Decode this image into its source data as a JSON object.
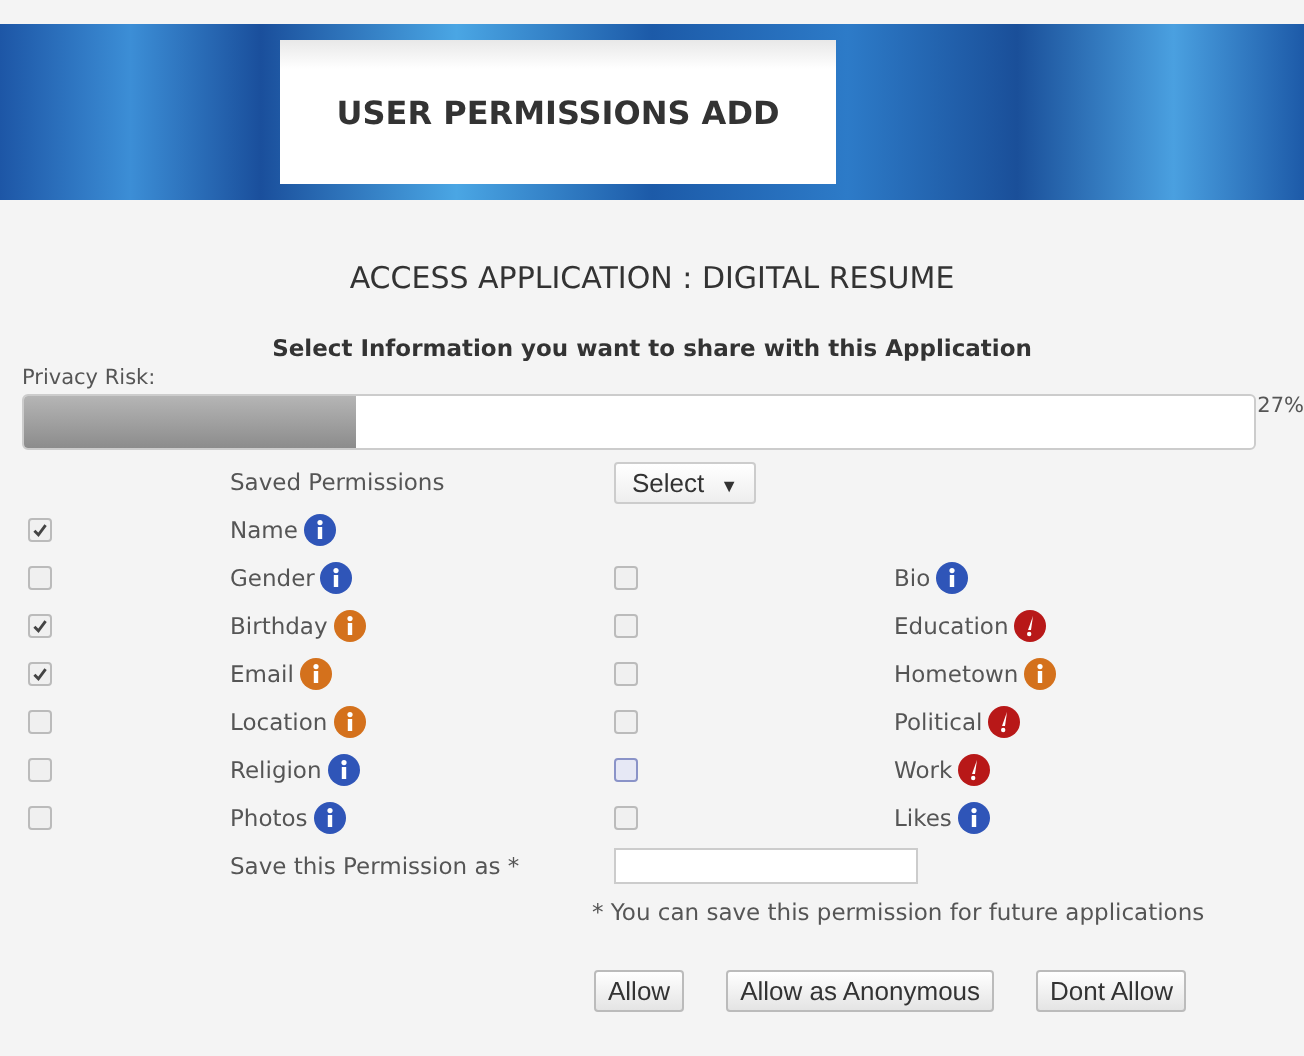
{
  "header": {
    "title": "USER PERMISSIONS ADD"
  },
  "app_title": "ACCESS APPLICATION : DIGITAL RESUME",
  "instruction": "Select Information you want to share with this Application",
  "privacy_risk": {
    "label": "Privacy Risk:",
    "level": 0.27,
    "reading": "27%"
  },
  "saved_permissions": {
    "label": "Saved Permissions",
    "value": "Select",
    "caret": "▼"
  },
  "rows": [
    {
      "left": {
        "label": "Name",
        "checked": true,
        "kind": "info",
        "color": "#2f55b8"
      }
    },
    {
      "left": {
        "label": "Gender",
        "checked": false,
        "kind": "info",
        "color": "#2f55b8"
      },
      "right": {
        "label": "Bio",
        "checked": false,
        "kind": "info",
        "color": "#2f55b8"
      }
    },
    {
      "left": {
        "label": "Birthday",
        "checked": true,
        "kind": "info",
        "color": "#d4711c"
      },
      "right": {
        "label": "Education",
        "checked": false,
        "kind": "warning",
        "color": "#b81818"
      }
    },
    {
      "left": {
        "label": "Email",
        "checked": true,
        "kind": "info",
        "color": "#d4711c"
      },
      "right": {
        "label": "Hometown",
        "checked": false,
        "kind": "info",
        "color": "#d4711c"
      }
    },
    {
      "left": {
        "label": "Location",
        "checked": false,
        "kind": "info",
        "color": "#d4711c"
      },
      "right": {
        "label": "Political",
        "checked": false,
        "kind": "warning",
        "color": "#b81818"
      }
    },
    {
      "left": {
        "label": "Religion",
        "checked": false,
        "kind": "info",
        "color": "#2f55b8"
      },
      "right": {
        "label": "Work",
        "checked": false,
        "focused": true,
        "kind": "warning",
        "color": "#b81818"
      }
    },
    {
      "left": {
        "label": "Photos",
        "checked": false,
        "kind": "info",
        "color": "#2f55b8"
      },
      "right": {
        "label": "Likes",
        "checked": false,
        "kind": "info",
        "color": "#2f55b8"
      }
    }
  ],
  "save_as": {
    "label": "Save this Permission as *",
    "note": "* You can save this permission for future applications"
  },
  "buttons": [
    "Allow",
    "Allow as Anonymous",
    "Dont Allow"
  ]
}
